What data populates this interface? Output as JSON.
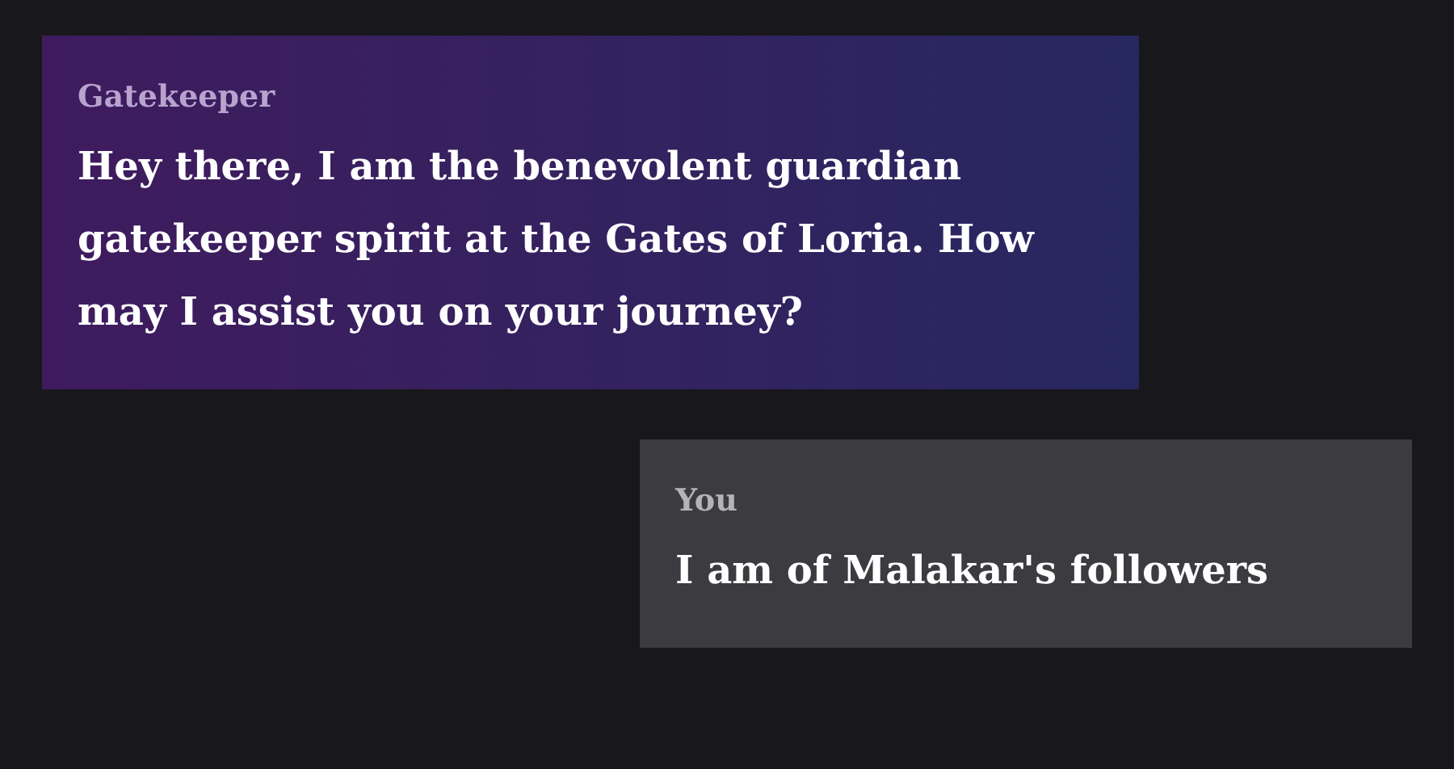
{
  "messages": [
    {
      "kind": "bot",
      "sender": "Gatekeeper",
      "text": "Hey there, I am the benevolent guardian gatekeeper spirit at the Gates of Loria. How may I assist you on your journey?"
    },
    {
      "kind": "user",
      "sender": "You",
      "text": "I am of Malakar's followers"
    }
  ]
}
